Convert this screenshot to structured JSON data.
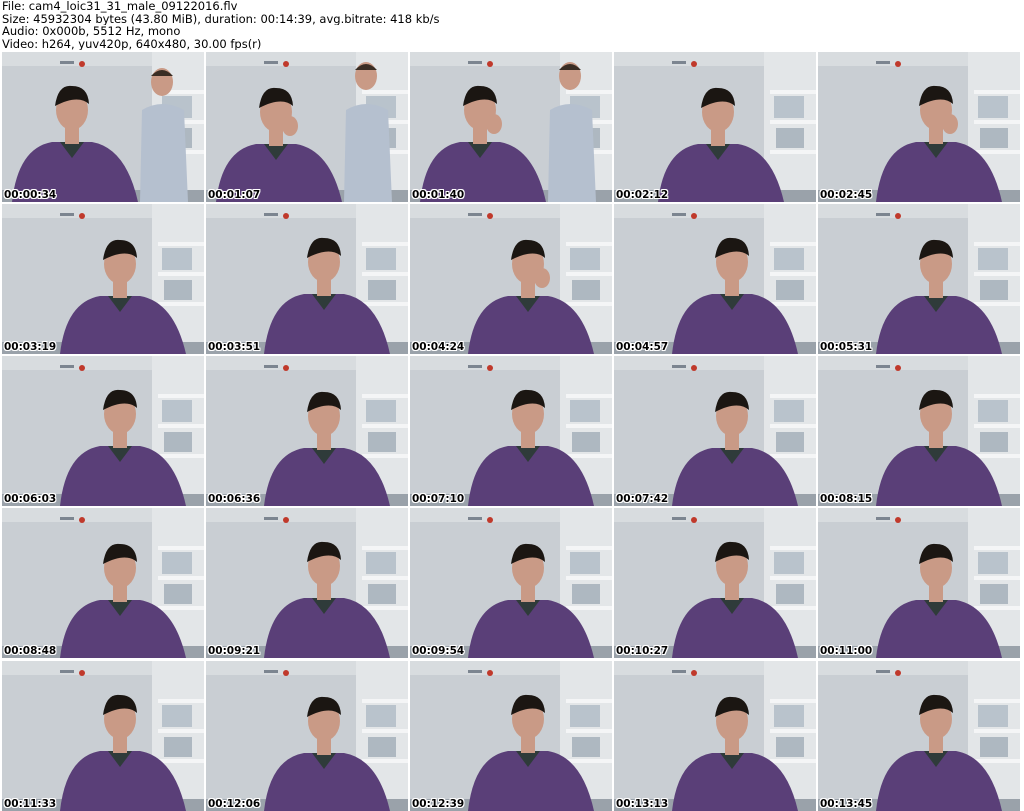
{
  "header": {
    "file_line": "File: cam4_loic31_31_male_09122016.flv",
    "size_line": "Size: 45932304 bytes (43.80 MiB), duration: 00:14:39, avg.bitrate: 418 kb/s",
    "audio_line": "Audio: 0x000b, 5512 Hz, mono",
    "video_line": "Video: h264, yuv420p, 640x480, 30.00 fps(r)"
  },
  "colors": {
    "wall": "#c9ced3",
    "sweater": "#5a3f78",
    "skin": "#c99a86",
    "hair": "#1b1612",
    "shirt_second_person": "#b5c0cf"
  },
  "frames": [
    {
      "timestamp": "00:00:34"
    },
    {
      "timestamp": "00:01:07"
    },
    {
      "timestamp": "00:01:40"
    },
    {
      "timestamp": "00:02:12"
    },
    {
      "timestamp": "00:02:45"
    },
    {
      "timestamp": "00:03:19"
    },
    {
      "timestamp": "00:03:51"
    },
    {
      "timestamp": "00:04:24"
    },
    {
      "timestamp": "00:04:57"
    },
    {
      "timestamp": "00:05:31"
    },
    {
      "timestamp": "00:06:03"
    },
    {
      "timestamp": "00:06:36"
    },
    {
      "timestamp": "00:07:10"
    },
    {
      "timestamp": "00:07:42"
    },
    {
      "timestamp": "00:08:15"
    },
    {
      "timestamp": "00:08:48"
    },
    {
      "timestamp": "00:09:21"
    },
    {
      "timestamp": "00:09:54"
    },
    {
      "timestamp": "00:10:27"
    },
    {
      "timestamp": "00:11:00"
    },
    {
      "timestamp": "00:11:33"
    },
    {
      "timestamp": "00:12:06"
    },
    {
      "timestamp": "00:12:39"
    },
    {
      "timestamp": "00:13:13"
    },
    {
      "timestamp": "00:13:45"
    }
  ]
}
